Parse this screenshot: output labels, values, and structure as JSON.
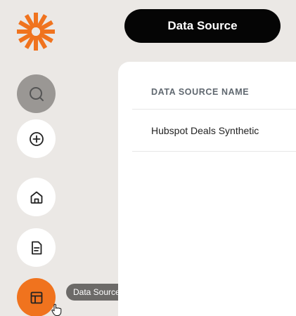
{
  "header": {
    "title": "Data Source"
  },
  "sidebar": {
    "items": [
      {
        "name": "search",
        "icon": "search-icon"
      },
      {
        "name": "add",
        "icon": "plus-circle-icon"
      },
      {
        "name": "home",
        "icon": "home-icon"
      },
      {
        "name": "documents",
        "icon": "document-icon"
      },
      {
        "name": "data-sources",
        "icon": "layout-icon",
        "active": true
      }
    ],
    "tooltip": "Data Sources"
  },
  "table": {
    "columns": [
      "DATA SOURCE NAME"
    ],
    "rows": [
      [
        "Hubspot Deals Synthetic"
      ]
    ]
  },
  "colors": {
    "accent": "#f0731e",
    "background": "#ebe8e5",
    "header_bg": "#050505"
  }
}
